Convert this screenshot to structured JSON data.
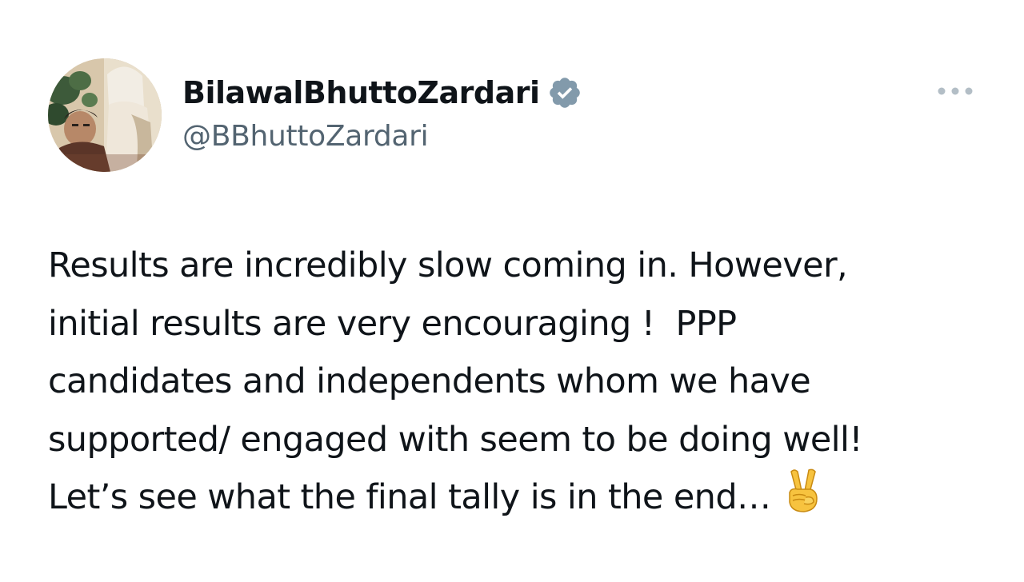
{
  "tweet": {
    "author": {
      "display_name": "BilawalBhuttoZardari",
      "handle": "@BBhuttoZardari",
      "verified_icon": "verified-badge-icon",
      "avatar_icon": "profile-photo"
    },
    "more_icon": "more-horizontal-icon",
    "text_lines": [
      "Results are incredibly slow coming in. However,",
      "initial results are very encouraging !  PPP",
      "candidates and independents whom we have",
      "supported/ engaged with seem to be doing well!",
      "Let’s see what the final tally is in the end…"
    ],
    "trailing_emoji": "victory-hand-emoji"
  },
  "colors": {
    "text_primary": "#0f1419",
    "text_secondary": "#536471",
    "verified_badge": "#829aab",
    "more_dots": "#b3bec6",
    "background": "#ffffff"
  }
}
